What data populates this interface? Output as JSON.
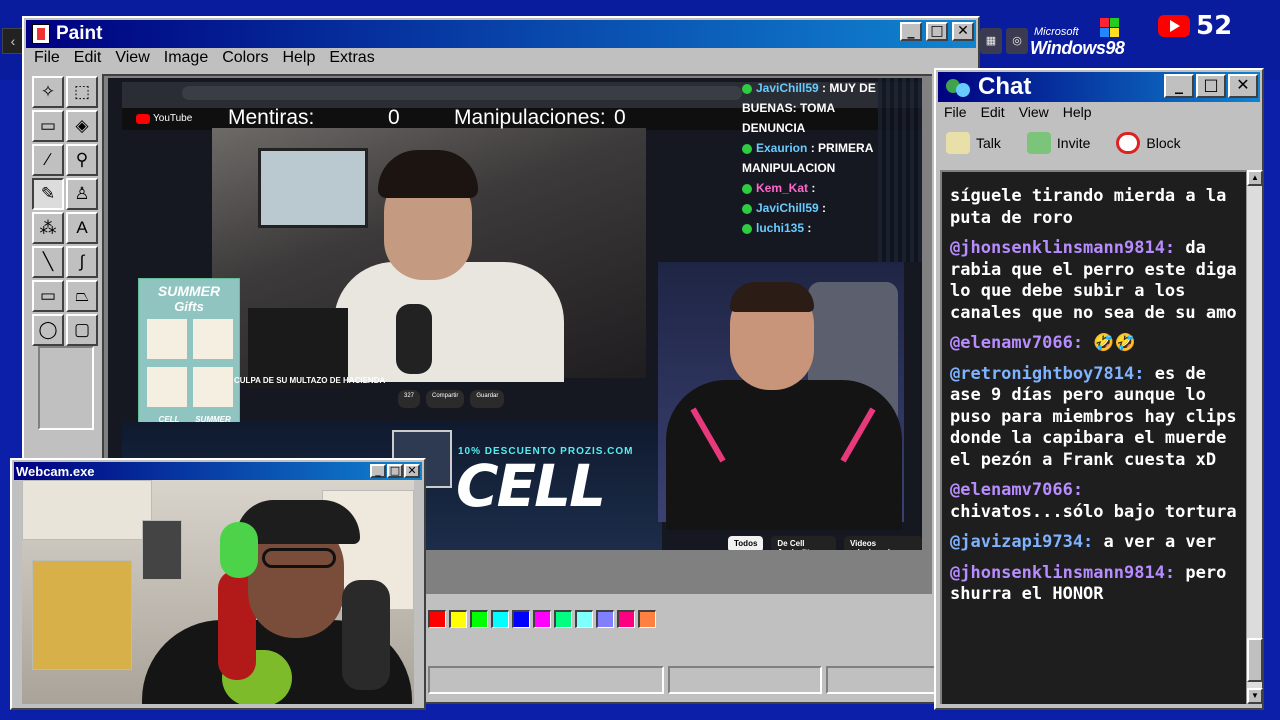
{
  "desktop": {
    "logo_small": "Microsoft",
    "logo_big": "Windows98",
    "youtube_count": "52"
  },
  "paint": {
    "title": "Paint",
    "menu": [
      "File",
      "Edit",
      "View",
      "Image",
      "Colors",
      "Help",
      "Extras"
    ],
    "palette": [
      "#ff0000",
      "#ffff00",
      "#00ff00",
      "#00ffff",
      "#0000ff",
      "#ff00ff",
      "#00ff80",
      "#80ffff",
      "#8080ff",
      "#ff0080",
      "#ff8040"
    ]
  },
  "stream": {
    "counter_mentiras_label": "Mentiras:",
    "counter_mentiras_value": "0",
    "counter_manip_label": "Manipulaciones:",
    "counter_manip_value": "0",
    "story_title": "CULPA DE SU MULTAZO DE HACIENDA",
    "promo_discount": "10% DESCUENTO PROZIS.COM",
    "promo_brand": "CELL",
    "gift_title": "SUMMER",
    "gift_sub": "Gifts",
    "gift_bottom": "SUMMER",
    "gift_cell": "CELL",
    "yt_tabs": [
      "Todos",
      "De Cell Junior™",
      "Videos relacionados"
    ],
    "yt_buttons": [
      "327",
      "Compartir",
      "Guardar"
    ],
    "overlay_chat": [
      {
        "user": "JaviChill59",
        "text": ": MUY DE"
      },
      {
        "user": "",
        "text": "BUENAS: TOMA"
      },
      {
        "user": "",
        "text": "DENUNCIA"
      },
      {
        "user": "Exaurion",
        "text": ": PRIMERA"
      },
      {
        "user": "",
        "text": "MANIPULACION"
      },
      {
        "user": "Kem_Kat",
        "text": ":"
      },
      {
        "user": "JaviChill59",
        "text": ":"
      },
      {
        "user": "luchi135",
        "text": ":"
      }
    ],
    "youtube_label": "YouTube"
  },
  "webcam": {
    "title": "Webcam.exe"
  },
  "chat": {
    "title": "Chat",
    "menu": [
      "File",
      "Edit",
      "View",
      "Help"
    ],
    "tools": [
      "Talk",
      "Invite",
      "Block"
    ],
    "messages": [
      {
        "user": "",
        "text": "síguele tirando mierda a la puta de roro"
      },
      {
        "user": "@jhonsenklinsmann9814:",
        "text": "da rabia que el perro este diga lo que debe subir a los canales que no sea de su amo"
      },
      {
        "user": "@elenamv7066:",
        "text": "🤣🤣"
      },
      {
        "user": "@retronightboy7814:",
        "text": "es de ase 9 días pero aunque lo puso para miembros hay clips donde la capibara el muerde el pezón a Frank cuesta xD"
      },
      {
        "user": "@elenamv7066:",
        "text": "chivatos...sólo bajo tortura"
      },
      {
        "user": "@javizapi9734:",
        "text": "a ver a ver"
      },
      {
        "user": "@jhonsenklinsmann9814:",
        "text": "pero shurra el HONOR"
      }
    ]
  }
}
